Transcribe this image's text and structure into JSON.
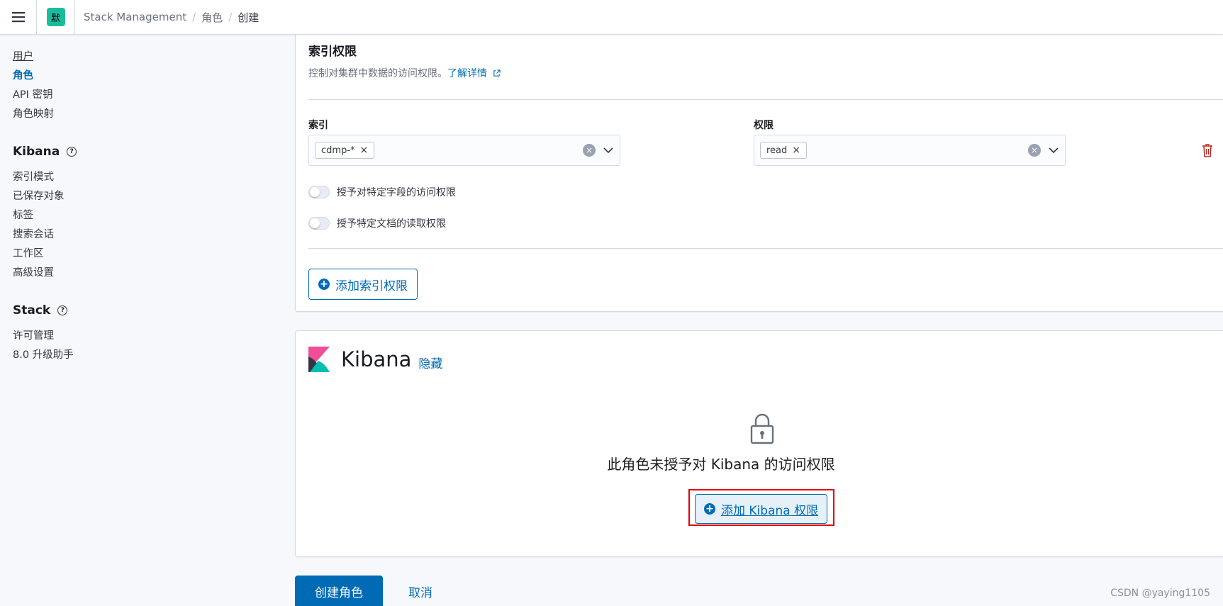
{
  "header": {
    "space_initial": "默",
    "breadcrumbs": [
      "Stack Management",
      "角色",
      "创建"
    ]
  },
  "sidebar": {
    "security_items": [
      "用户",
      "角色",
      "API 密钥",
      "角色映射"
    ],
    "kibana_title": "Kibana",
    "kibana_items": [
      "索引模式",
      "已保存对象",
      "标签",
      "搜索会话",
      "工作区",
      "高级设置"
    ],
    "stack_title": "Stack",
    "stack_items": [
      "许可管理",
      "8.0 升级助手"
    ]
  },
  "index_privileges": {
    "title": "索引权限",
    "description": "控制对集群中数据的访问权限。",
    "learn_more": "了解详情",
    "indices_label": "索引",
    "indices_value": "cdmp-*",
    "privileges_label": "权限",
    "privileges_value": "read",
    "field_security_label": "授予对特定字段的访问权限",
    "document_security_label": "授予特定文档的读取权限",
    "add_button": "添加索引权限"
  },
  "kibana_section": {
    "title": "Kibana",
    "hide_link": "隐藏",
    "empty_message": "此角色未授予对 Kibana 的访问权限",
    "add_button": "添加 Kibana 权限"
  },
  "footer": {
    "create_button": "创建角色",
    "cancel_button": "取消"
  },
  "watermark": "CSDN @yaying1105",
  "colors": {
    "primary": "#006bb4",
    "highlight_box": "#e5000d",
    "space_avatar": "#1bbc9b",
    "danger": "#bd271e"
  }
}
